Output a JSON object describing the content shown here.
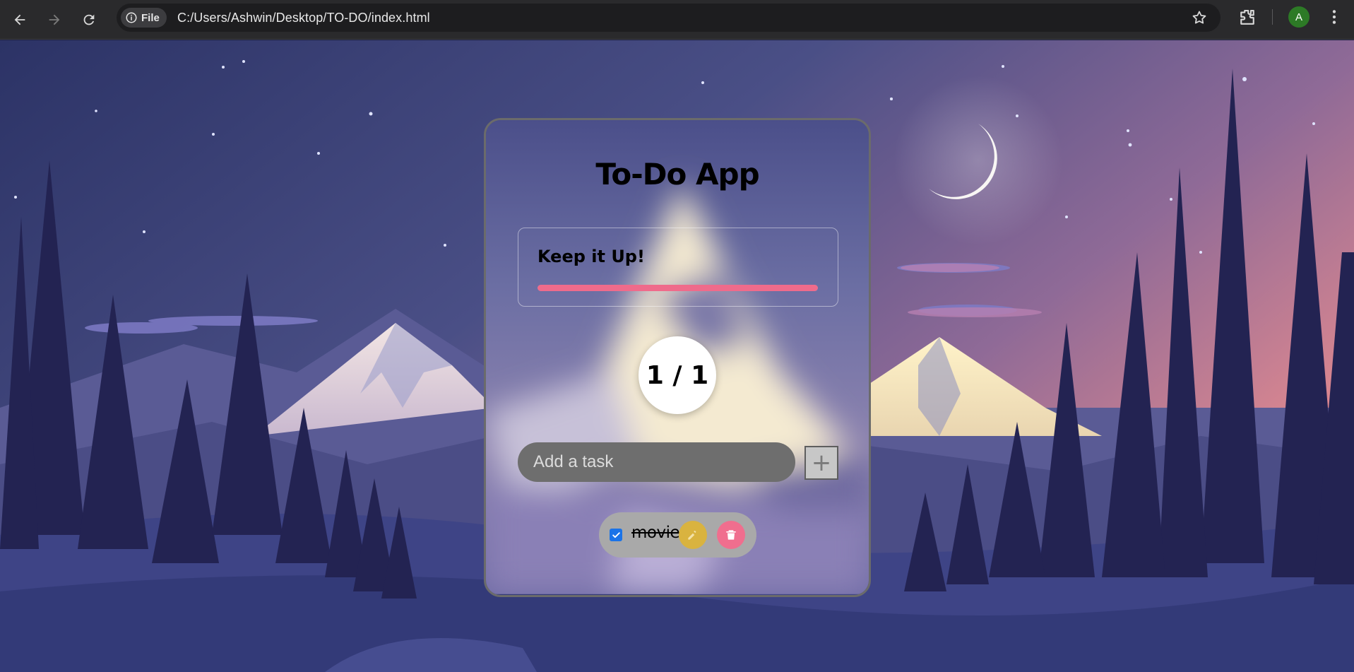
{
  "browser": {
    "site_chip_label": "File",
    "url": "C:/Users/Ashwin/Desktop/TO-DO/index.html",
    "profile_initial": "A"
  },
  "app": {
    "title": "To-Do App",
    "stats": {
      "message": "Keep it Up!",
      "progress_percent": 100
    },
    "counter": "1 / 1",
    "input": {
      "placeholder": "Add a task",
      "value": ""
    },
    "add_button_label": "+",
    "tasks": [
      {
        "text": "movie",
        "completed": true
      }
    ]
  },
  "colors": {
    "progress_fill": "#ef6b8b",
    "edit_button": "#d9b33f",
    "delete_button": "#f06e8e",
    "checkbox": "#1a73e8"
  }
}
